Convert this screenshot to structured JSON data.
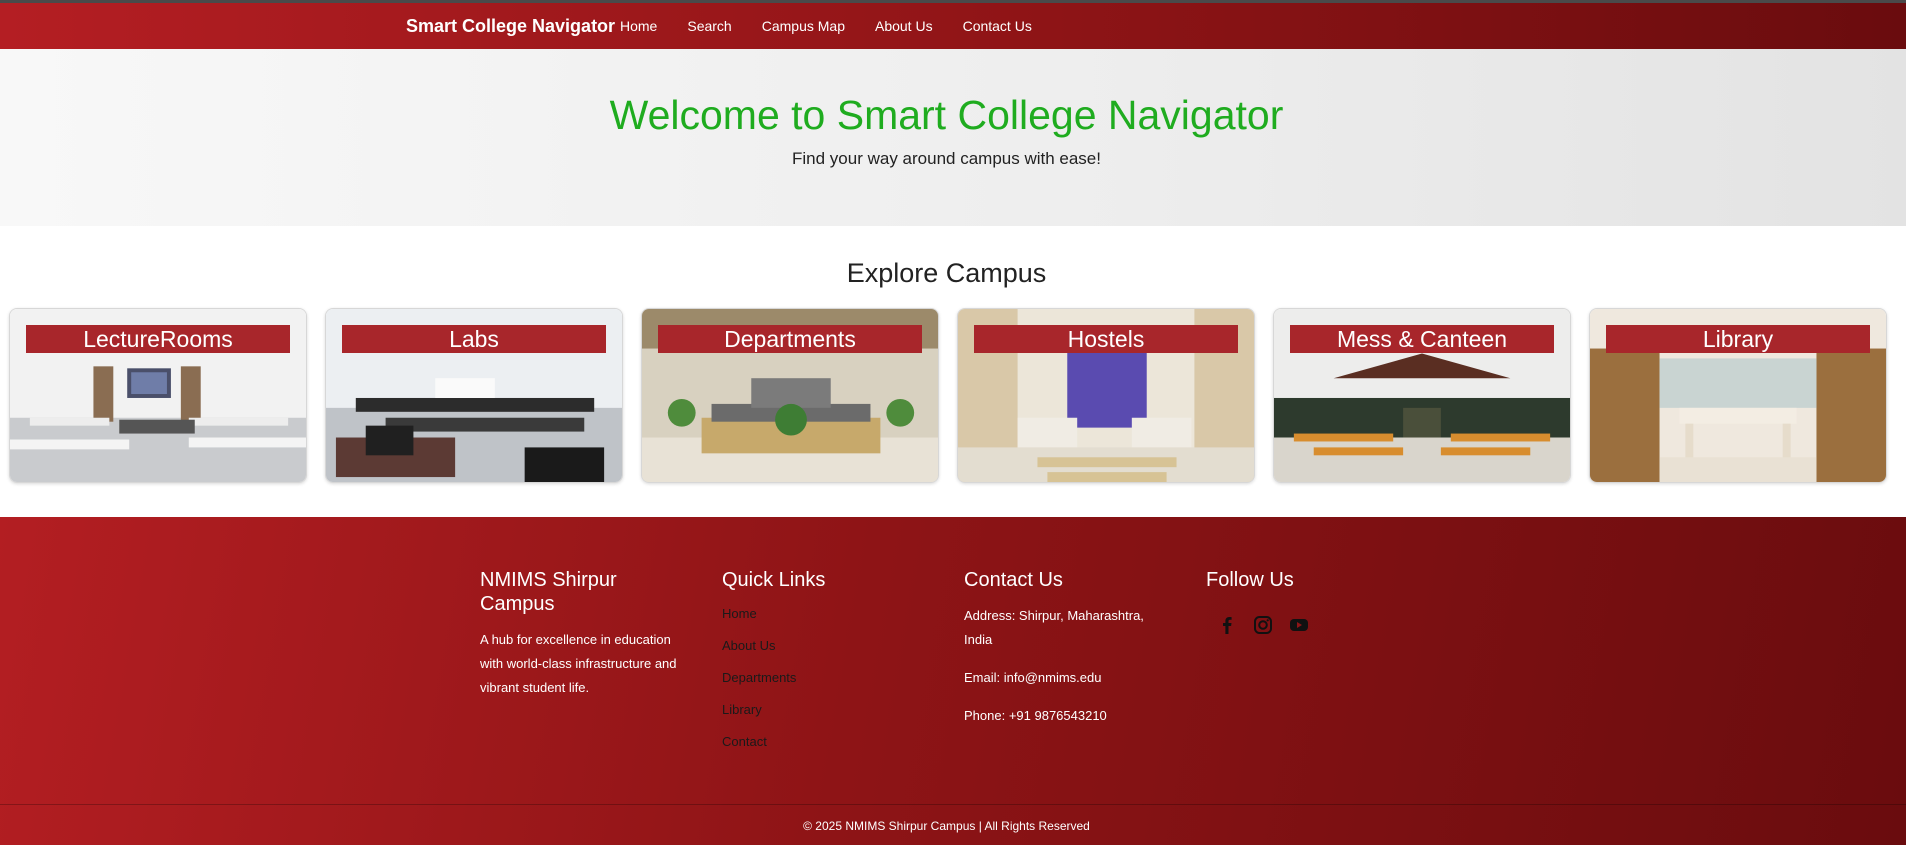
{
  "navbar": {
    "brand": "Smart College Navigator",
    "links": [
      "Home",
      "Search",
      "Campus Map",
      "About Us",
      "Contact Us"
    ]
  },
  "hero": {
    "title": "Welcome to Smart College Navigator",
    "subtitle": "Find your way around campus with ease!"
  },
  "explore": {
    "title": "Explore Campus",
    "cards": [
      {
        "label": "LectureRooms"
      },
      {
        "label": "Labs"
      },
      {
        "label": "Departments"
      },
      {
        "label": "Hostels"
      },
      {
        "label": "Mess & Canteen"
      },
      {
        "label": "Library"
      }
    ]
  },
  "footer": {
    "about": {
      "title": "NMIMS Shirpur Campus",
      "text": "A hub for excellence in education with world-class infrastructure and vibrant student life."
    },
    "quick_links": {
      "title": "Quick Links",
      "links": [
        "Home",
        "About Us",
        "Departments",
        "Library",
        "Contact"
      ]
    },
    "contact": {
      "title": "Contact Us",
      "address": "Address: Shirpur, Maharashtra, India",
      "email": "Email: info@nmims.edu",
      "phone": "Phone: +91 9876543210"
    },
    "follow": {
      "title": "Follow Us",
      "icons": [
        "facebook-icon",
        "instagram-icon",
        "youtube-icon"
      ]
    },
    "copyright": "© 2025 NMIMS Shirpur Campus | All Rights Reserved"
  },
  "colors": {
    "primary_red": "#a8262b",
    "hero_title_green": "#1fac1f",
    "footer_link": "#1a1a1a"
  }
}
